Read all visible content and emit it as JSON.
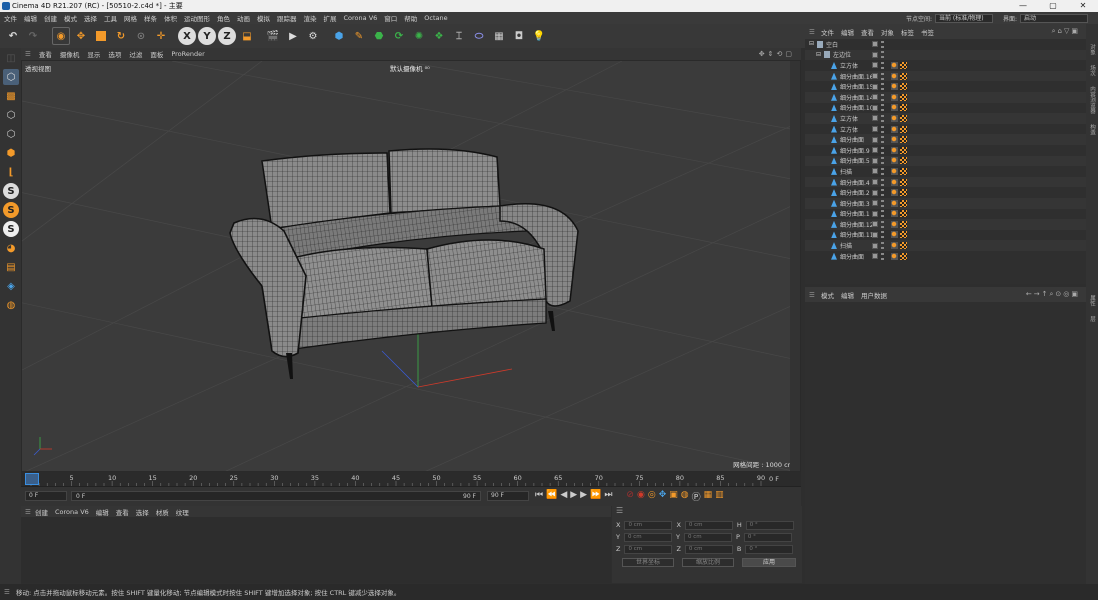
{
  "window": {
    "title": "Cinema 4D R21.207 (RC) - [50510-2.c4d *] - 主要",
    "controls": [
      "—",
      "▢",
      "✕"
    ]
  },
  "menu": {
    "items": [
      "文件",
      "编辑",
      "创建",
      "模式",
      "选择",
      "工具",
      "网格",
      "样条",
      "体积",
      "运动图形",
      "角色",
      "动画",
      "模拟",
      "跟踪器",
      "渲染",
      "扩展",
      "Corona V6",
      "窗口",
      "帮助",
      "Octane"
    ],
    "nodespace_label": "节点空间:",
    "nodespace_value": "当前 (标准/物理)",
    "layout_label": "界面:",
    "layout_value": "启动"
  },
  "toolbar": {
    "axis_x": "X",
    "axis_y": "Y",
    "axis_z": "Z"
  },
  "viewport": {
    "menu": [
      "查看",
      "摄像机",
      "显示",
      "选项",
      "过滤",
      "面板",
      "ProRender"
    ],
    "view_name": "透视视图",
    "camera": "默认摄像机 ⁰⁰",
    "grid_label": "网格间距 : 1000 cm"
  },
  "timeline": {
    "ticks": [
      "0",
      "5",
      "10",
      "15",
      "20",
      "25",
      "30",
      "35",
      "40",
      "45",
      "50",
      "55",
      "60",
      "65",
      "70",
      "75",
      "80",
      "85",
      "90"
    ],
    "current_frame_right": "0 F",
    "start_frame": "0 F",
    "min_frame": "0 F",
    "max_frame": "90 F",
    "end_frame": "90 F"
  },
  "material": {
    "menu": [
      "创建",
      "Corona V6",
      "编辑",
      "查看",
      "选择",
      "材质",
      "纹理"
    ]
  },
  "coords": {
    "rows": [
      {
        "a": "X",
        "av": "0 cm",
        "b": "X",
        "bv": "0 cm",
        "c": "H",
        "cv": "0 °"
      },
      {
        "a": "Y",
        "av": "0 cm",
        "b": "Y",
        "bv": "0 cm",
        "c": "P",
        "cv": "0 °"
      },
      {
        "a": "Z",
        "av": "0 cm",
        "b": "Z",
        "bv": "0 cm",
        "c": "B",
        "cv": "0 °"
      }
    ],
    "mode1": "世界坐标",
    "mode2": "缩放比例",
    "apply": "应用"
  },
  "objects": {
    "menu": [
      "文件",
      "编辑",
      "查看",
      "对象",
      "标签",
      "书签"
    ],
    "rows": [
      {
        "name": "空白",
        "indent": 0,
        "tags": false
      },
      {
        "name": "左边位",
        "indent": 1,
        "tags": false
      },
      {
        "name": "立方体",
        "indent": 2,
        "tags": true
      },
      {
        "name": "细分曲面.16",
        "indent": 2,
        "tags": true
      },
      {
        "name": "细分曲面.15",
        "indent": 2,
        "tags": true
      },
      {
        "name": "细分曲面.14",
        "indent": 2,
        "tags": true
      },
      {
        "name": "细分曲面.10",
        "indent": 2,
        "tags": true
      },
      {
        "name": "立方体",
        "indent": 2,
        "tags": true
      },
      {
        "name": "立方体",
        "indent": 2,
        "tags": true
      },
      {
        "name": "细分曲面",
        "indent": 2,
        "tags": true
      },
      {
        "name": "细分曲面.9",
        "indent": 2,
        "tags": true
      },
      {
        "name": "细分曲面.5",
        "indent": 2,
        "tags": true
      },
      {
        "name": "扫描",
        "indent": 2,
        "tags": true
      },
      {
        "name": "细分曲面.4",
        "indent": 2,
        "tags": true
      },
      {
        "name": "细分曲面.2",
        "indent": 2,
        "tags": true
      },
      {
        "name": "细分曲面.3",
        "indent": 2,
        "tags": true
      },
      {
        "name": "细分曲面.1",
        "indent": 2,
        "tags": true
      },
      {
        "name": "细分曲面.12",
        "indent": 2,
        "tags": true
      },
      {
        "name": "细分曲面.11",
        "indent": 2,
        "tags": true
      },
      {
        "name": "扫描",
        "indent": 2,
        "tags": true
      },
      {
        "name": "细分曲面",
        "indent": 2,
        "tags": true
      }
    ]
  },
  "attributes": {
    "menu": [
      "模式",
      "编辑",
      "用户数据"
    ]
  },
  "rightstrip": [
    "对象",
    "场次",
    "内容浏览器",
    "构造"
  ],
  "rightstrip_lower": [
    "属性",
    "层"
  ],
  "status": "移动: 点击并拖动鼠标移动元素。按住 SHIFT 键量化移动; 节点编辑模式时按住 SHIFT 键增加选择对象; 按住 CTRL 键减少选择对象。",
  "colors": {
    "accent": "#f39a2a",
    "cube_blue": "#4aa3e8",
    "green": "#3bb34a"
  }
}
